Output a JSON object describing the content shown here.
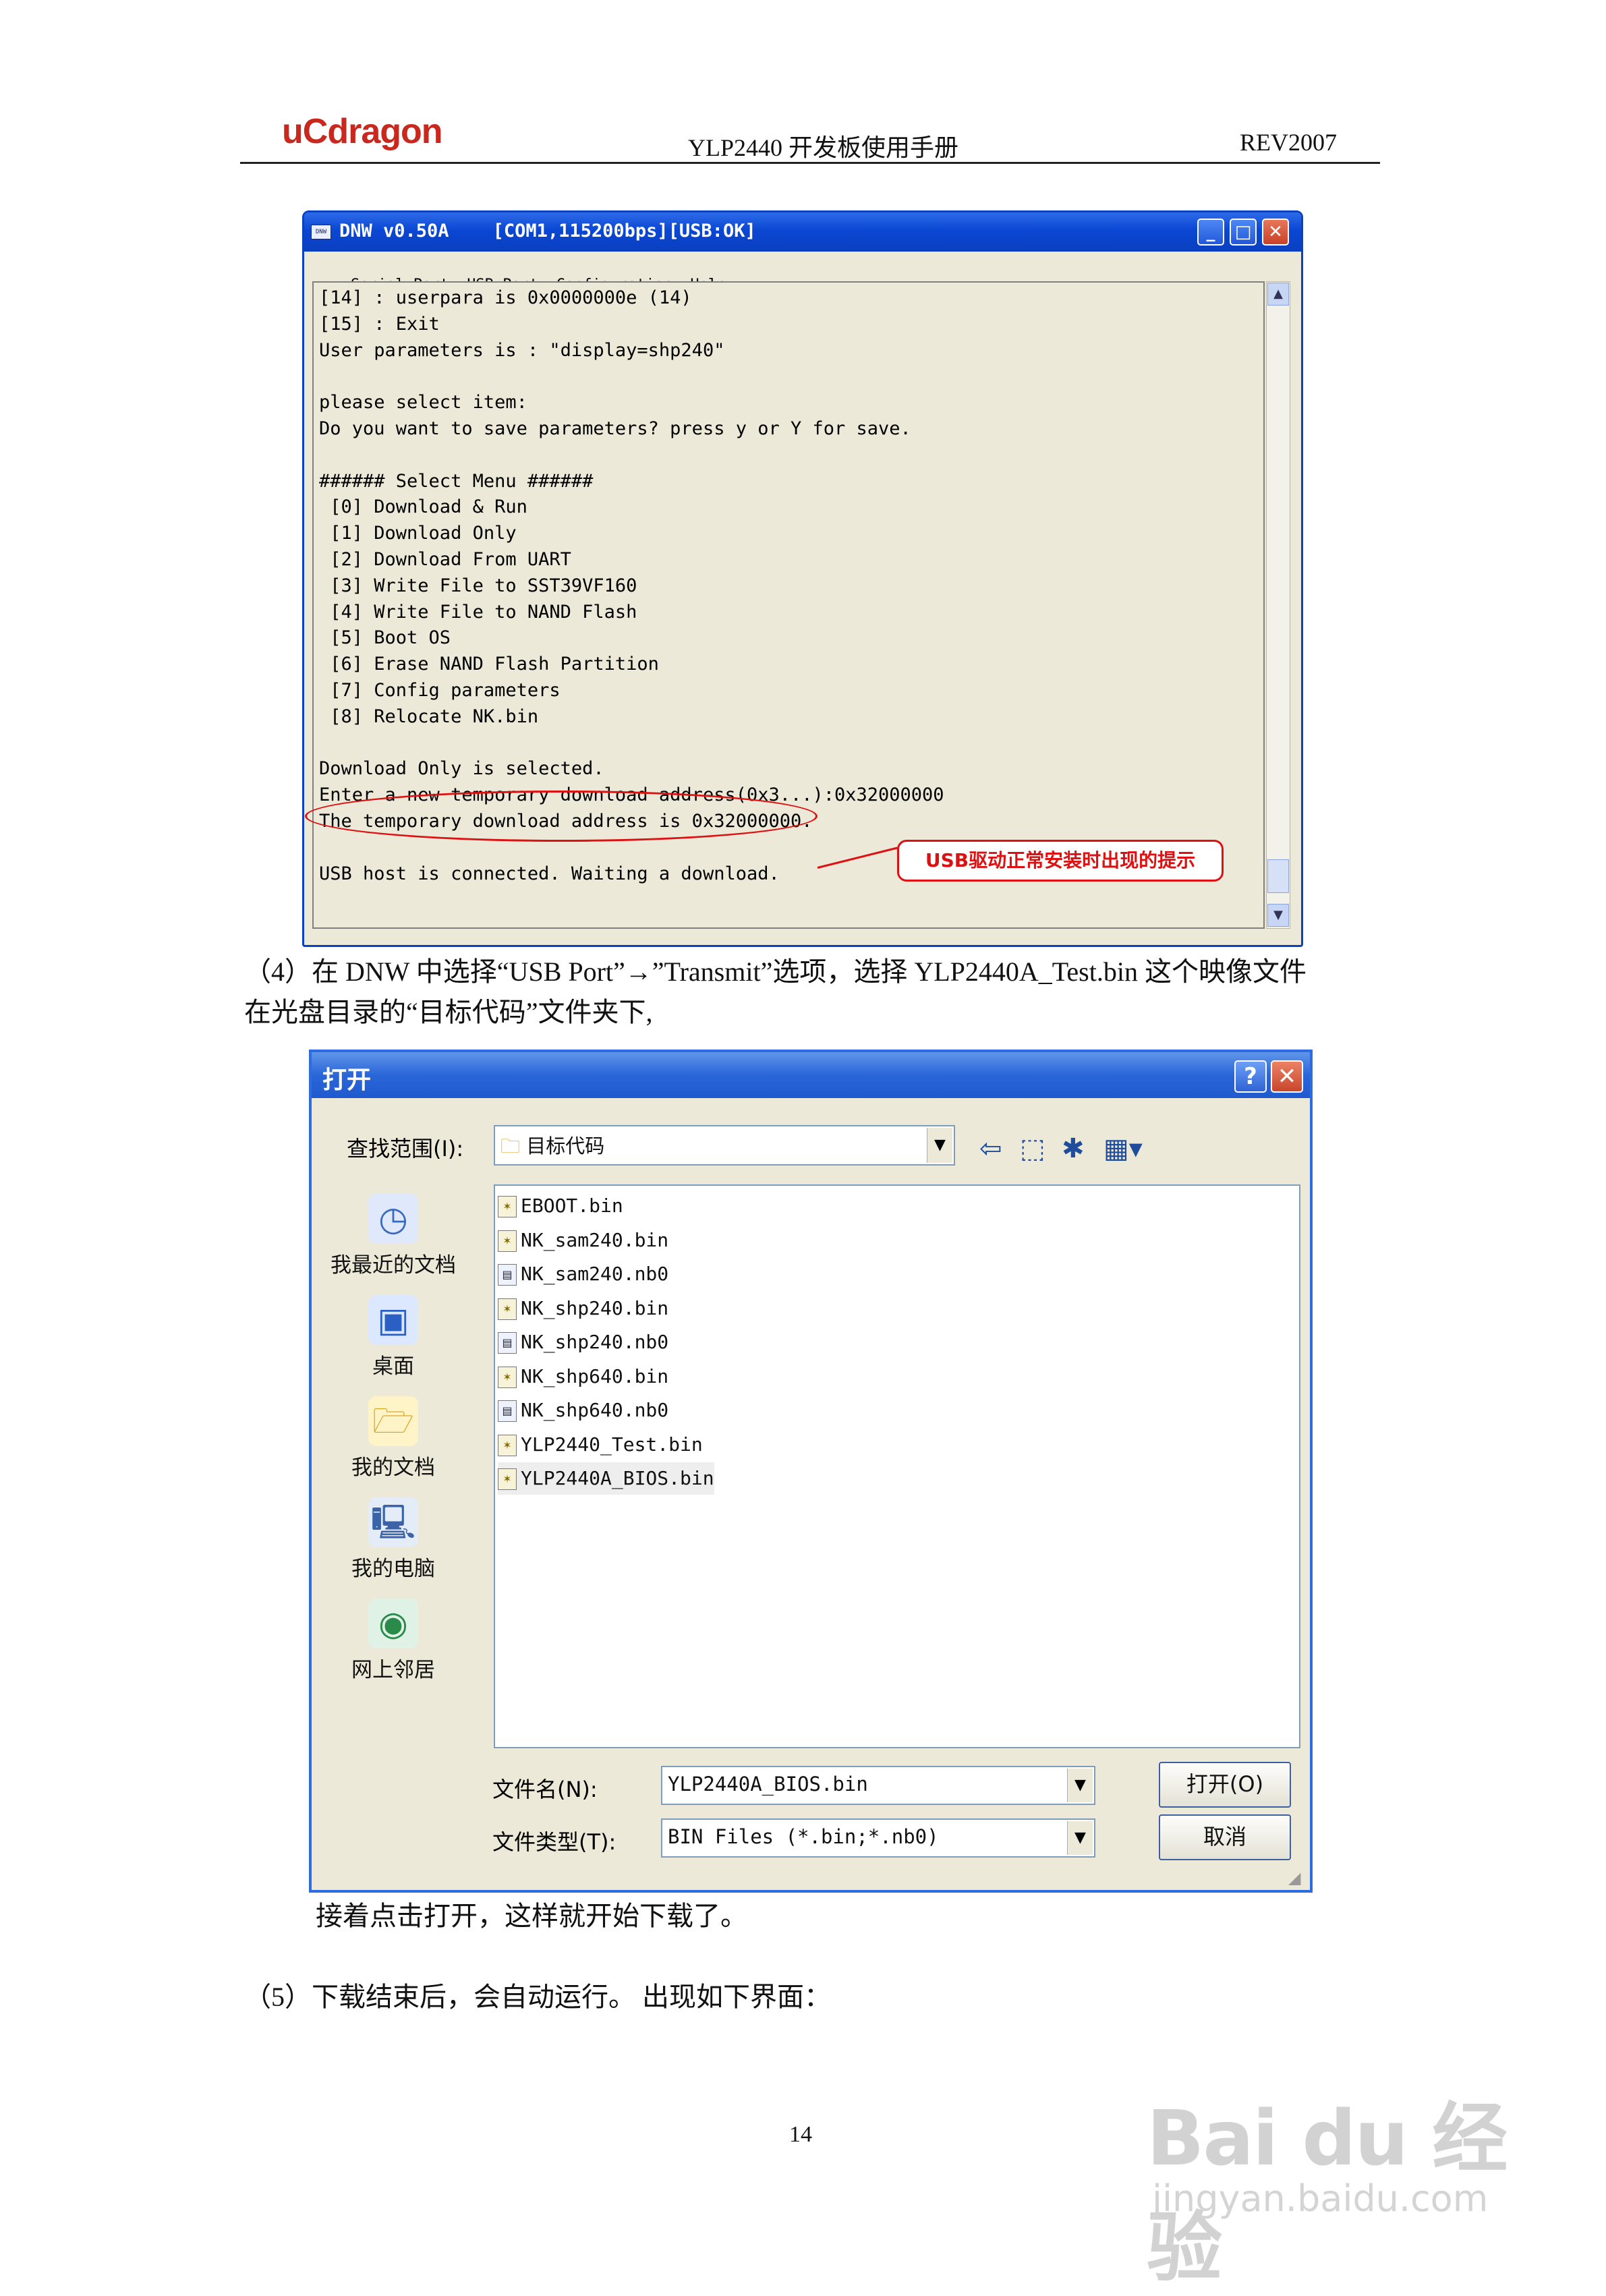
{
  "header": {
    "logo": "uCdragon",
    "title": "YLP2440 开发板使用手册",
    "revision": "REV2007"
  },
  "dnw": {
    "title": "DNW v0.50A    [COM1,115200bps][USB:OK]",
    "menu": [
      "Serial Port",
      "USB Port",
      "Configuration",
      "Help"
    ],
    "console_lines": [
      "[14] : userpara is 0x0000000e (14)",
      "[15] : Exit",
      "User parameters is : \"display=shp240\"",
      "",
      "please select item:",
      "Do you want to save parameters? press y or Y for save.",
      "",
      "###### Select Menu ######",
      " [0] Download & Run",
      " [1] Download Only",
      " [2] Download From UART",
      " [3] Write File to SST39VF160",
      " [4] Write File to NAND Flash",
      " [5] Boot OS",
      " [6] Erase NAND Flash Partition",
      " [7] Config parameters",
      " [8] Relocate NK.bin",
      "",
      "Download Only is selected.",
      "Enter a new temporary download address(0x3...):0x32000000",
      "The temporary download address is 0x32000000.",
      "",
      "USB host is connected. Waiting a download."
    ],
    "callout": "USB驱动正常安装时出现的提示"
  },
  "para4_line1": "（4）在 DNW 中选择“USB Port”→”Transmit”选项，选择 YLP2440A_Test.bin 这个映像文件",
  "para4_line2": "在光盘目录的“目标代码”文件夹下,",
  "dialog": {
    "title": "打开",
    "help_label": "?",
    "close_label": "✕",
    "look_in_label": "查找范围(I):",
    "look_in_value": "目标代码",
    "places": [
      "我最近的文档",
      "桌面",
      "我的文档",
      "我的电脑",
      "网上邻居"
    ],
    "files": [
      {
        "name": "EBOOT.bin",
        "type": "bin"
      },
      {
        "name": "NK_sam240.bin",
        "type": "bin"
      },
      {
        "name": "NK_sam240.nb0",
        "type": "nb0"
      },
      {
        "name": "NK_shp240.bin",
        "type": "bin"
      },
      {
        "name": "NK_shp240.nb0",
        "type": "nb0"
      },
      {
        "name": "NK_shp640.bin",
        "type": "bin"
      },
      {
        "name": "NK_shp640.nb0",
        "type": "nb0"
      },
      {
        "name": "YLP2440_Test.bin",
        "type": "bin"
      },
      {
        "name": "YLP2440A_BIOS.bin",
        "type": "bin",
        "selected": true
      }
    ],
    "filename_label": "文件名(N):",
    "filename_value": "YLP2440A_BIOS.bin",
    "filetype_label": "文件类型(T):",
    "filetype_value": "BIN Files (*.bin;*.nb0)",
    "open_button": "打开(O)",
    "cancel_button": "取消"
  },
  "after_dialog": "接着点击打开，这样就开始下载了。",
  "para5": "（5）下载结束后，会自动运行。 出现如下界面：",
  "page_number": "14",
  "watermark": {
    "brand": "Bai du 经验",
    "url": "jingyan.baidu.com"
  }
}
